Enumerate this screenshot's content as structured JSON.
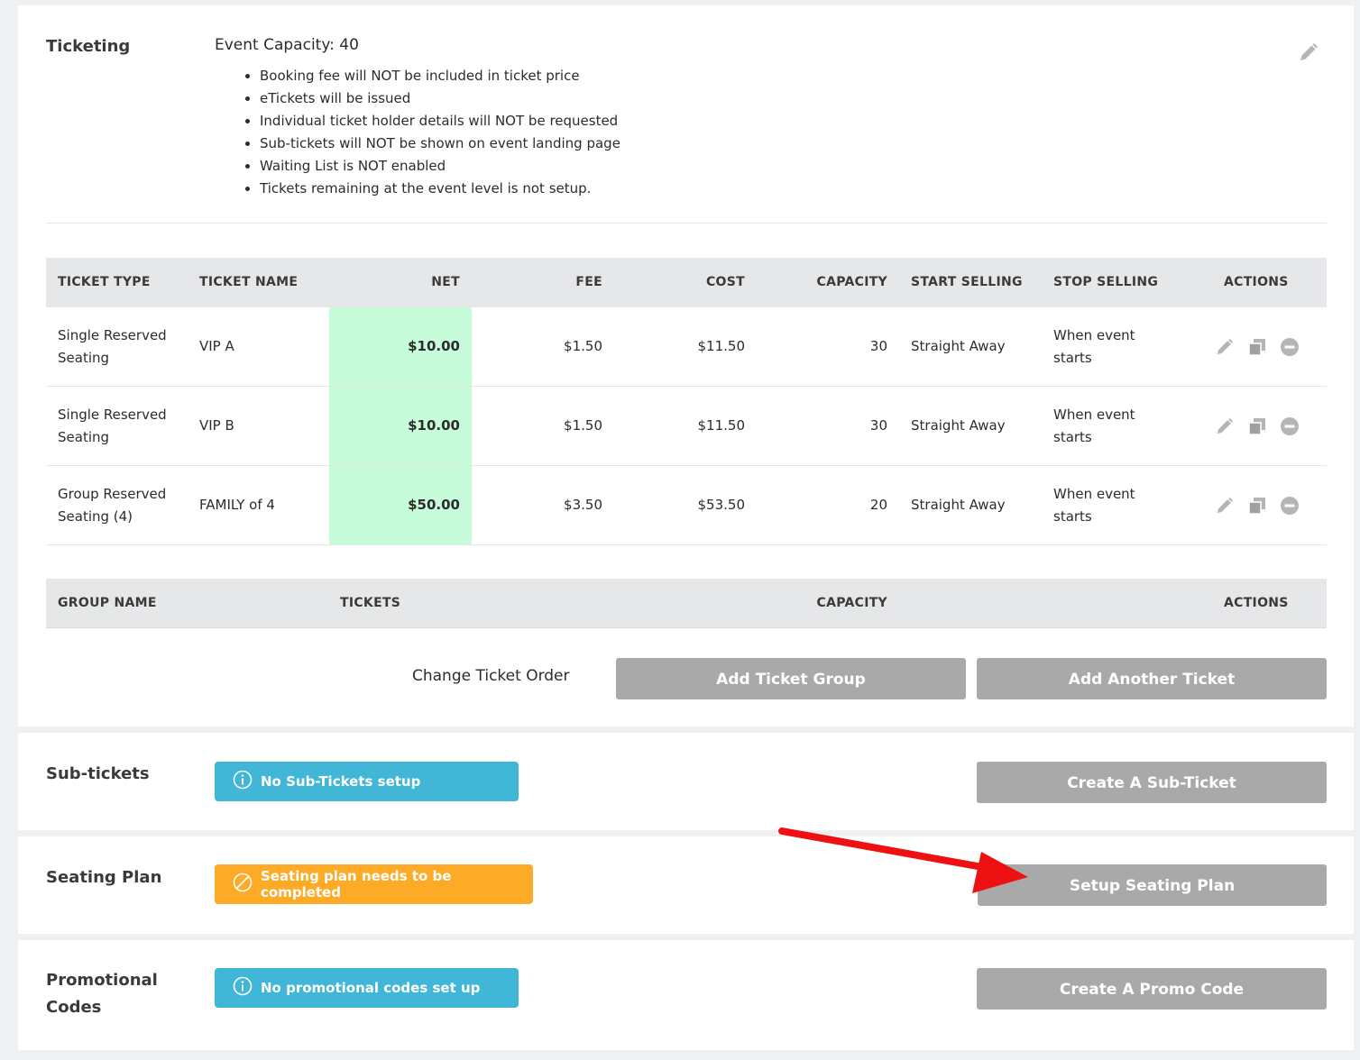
{
  "ticketing": {
    "title": "Ticketing",
    "event_capacity": "Event Capacity: 40",
    "bullets": [
      "Booking fee will NOT be included in ticket price",
      "eTickets will be issued",
      "Individual ticket holder details will NOT be requested",
      "Sub-tickets will NOT be shown on event landing page",
      "Waiting List is NOT enabled",
      "Tickets remaining at the event level is not setup."
    ],
    "edit_icon": "pencil-icon"
  },
  "tickets_table": {
    "headers": {
      "type": "TICKET TYPE",
      "name": "TICKET NAME",
      "net": "NET",
      "fee": "FEE",
      "cost": "COST",
      "capacity": "CAPACITY",
      "start": "START SELLING",
      "stop": "STOP SELLING",
      "actions": "ACTIONS"
    },
    "rows": [
      {
        "type_line1": "Single Reserved",
        "type_line2": "Seating",
        "name": "VIP A",
        "net": "$10.00",
        "fee": "$1.50",
        "cost": "$11.50",
        "capacity": "30",
        "start": "Straight Away",
        "stop_line1": "When event",
        "stop_line2": "starts"
      },
      {
        "type_line1": "Single Reserved",
        "type_line2": "Seating",
        "name": "VIP B",
        "net": "$10.00",
        "fee": "$1.50",
        "cost": "$11.50",
        "capacity": "30",
        "start": "Straight Away",
        "stop_line1": "When event",
        "stop_line2": "starts"
      },
      {
        "type_line1": "Group Reserved",
        "type_line2": "Seating (4)",
        "name": "FAMILY of 4",
        "net": "$50.00",
        "fee": "$3.50",
        "cost": "$53.50",
        "capacity": "20",
        "start": "Straight Away",
        "stop_line1": "When event",
        "stop_line2": "starts"
      }
    ],
    "row_action_icons": [
      "pencil-icon",
      "copy-icon",
      "minus-circle-icon"
    ]
  },
  "groups_table": {
    "headers": {
      "group_name": "GROUP NAME",
      "tickets": "TICKETS",
      "capacity": "CAPACITY",
      "actions": "ACTIONS"
    }
  },
  "ticket_buttons": {
    "change_order": "Change Ticket Order",
    "add_group": "Add Ticket Group",
    "add_ticket": "Add Another Ticket"
  },
  "sub_tickets": {
    "title": "Sub-tickets",
    "alert": "No Sub-Tickets setup",
    "button": "Create A Sub-Ticket"
  },
  "seating_plan": {
    "title": "Seating Plan",
    "alert": "Seating plan needs to be completed",
    "button": "Setup Seating Plan"
  },
  "promo_codes": {
    "title_line1": "Promotional",
    "title_line2": "Codes",
    "alert": "No promotional codes set up",
    "button": "Create A Promo Code"
  },
  "colors": {
    "net_highlight": "#c6fcd9",
    "button_gray": "#a9a9a9",
    "info_blue": "#41b6d6",
    "warning_orange": "#fdaa27",
    "annotation_red": "#ee1111"
  }
}
